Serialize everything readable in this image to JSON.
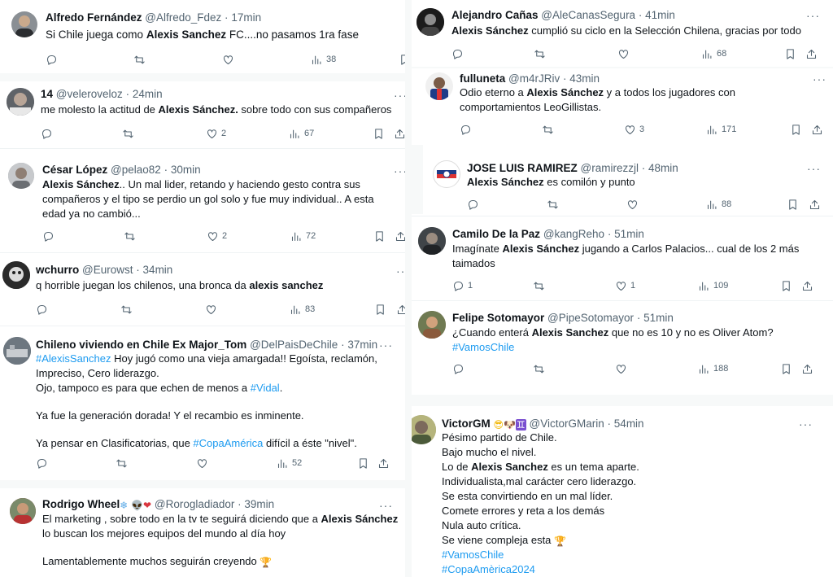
{
  "left": [
    {
      "name": "Alfredo Fernández",
      "handle": "@Alfredo_Fdez",
      "time": "17min",
      "text": "Si Chile juega como ",
      "bold": "Alexis Sanchez",
      "text2": " FC....no pasamos 1ra fase",
      "replies": "",
      "retweets": "",
      "likes": "",
      "views": "38"
    },
    {
      "name": "14",
      "handle": "@veleroveloz",
      "time": "24min",
      "text": "me molesto la actitud de ",
      "bold": "Alexis Sánchez.",
      "text2": " sobre todo con sus compañeros",
      "replies": "",
      "retweets": "",
      "likes": "2",
      "views": "67"
    },
    {
      "name": "César López",
      "handle": "@pelao82",
      "time": "30min",
      "bold": "Alexis Sánchez",
      "text2": ".. Un mal lider, retando y haciendo gesto contra sus",
      "line2": "compañeros y el tipo se perdio un gol solo y fue muy individual.. A esta",
      "line3": "edad ya no cambió...",
      "replies": "",
      "retweets": "",
      "likes": "2",
      "views": "72"
    },
    {
      "name": "wchurro",
      "handle": "@Eurowst",
      "time": "34min",
      "text": "q horrible juegan los chilenos, una bronca da ",
      "bold": "alexis sanchez",
      "replies": "",
      "retweets": "",
      "likes": "",
      "views": "83"
    },
    {
      "name": "Chileno viviendo en Chile Ex Major_Tom",
      "handle": "@DelPaisDeChile",
      "time": "37min",
      "tag1": "#AlexisSanchez",
      "text1": " Hoy jugó como una vieja amargada!! Egoísta, reclamón,",
      "line2": "Impreciso, Cero liderazgo.",
      "line3a": "Ojo, tampoco es para que echen de menos a ",
      "tag2": "#Vidal",
      "line3b": ".",
      "line4": "Ya fue la generación dorada! Y el recambio es inminente.",
      "line5a": "Ya pensar en Clasificatorias, que ",
      "tag3": "#CopaAmérica",
      "line5b": " difícil a éste \"nivel\".",
      "replies": "",
      "retweets": "",
      "likes": "",
      "views": "52"
    },
    {
      "name": "Rodrigo Wheel",
      "handle": "@Rorogladiador",
      "time": "39min",
      "text": "El marketing  , sobre todo en la tv te seguirá diciendo que a ",
      "bold": "Alexis Sánchez",
      "line2": "lo buscan los mejores equipos del mundo al día hoy",
      "line3": "Lamentablemente muchos seguirán creyendo"
    }
  ],
  "right": [
    {
      "name": "Alejandro Cañas",
      "handle": "@AleCanasSegura",
      "time": "41min",
      "bold": "Alexis Sánchez",
      "text2": " cumplió su ciclo en la Selección Chilena, gracias por todo",
      "replies": "",
      "retweets": "",
      "likes": "",
      "views": "68"
    },
    {
      "name": "fulluneta",
      "handle": "@m4rJRiv",
      "time": "43min",
      "text": "Odio eterno a ",
      "bold": "Alexis Sánchez",
      "text2": " y a todos los jugadores con",
      "line2": "comportamientos LeoGillistas.",
      "replies": "",
      "retweets": "",
      "likes": "3",
      "views": "171"
    },
    {
      "name": "JOSE LUIS RAMIREZ",
      "handle": "@ramirezzjl",
      "time": "48min",
      "bold": "Alexis Sánchez",
      "text2": " es comilón y punto",
      "replies": "",
      "retweets": "",
      "likes": "",
      "views": "88"
    },
    {
      "name": "Camilo De la Paz",
      "handle": "@kangReho",
      "time": "51min",
      "text": "Imagínate ",
      "bold": "Alexis Sánchez",
      "text2": " jugando a Carlos Palacios... cual de los 2 más",
      "line2": "taimados",
      "replies": "1",
      "retweets": "",
      "likes": "1",
      "views": "109"
    },
    {
      "name": "Felipe Sotomayor",
      "handle": "@PipeSotomayor",
      "time": "51min",
      "text": "¿Cuando enterá ",
      "bold": "Alexis Sanchez",
      "text2": " que no es 10 y no es Oliver Atom?",
      "tag1": "#VamosChile",
      "replies": "",
      "retweets": "",
      "likes": "",
      "views": "188"
    },
    {
      "name": "VictorGM",
      "handle": "@VictorGMarin",
      "time": "54min",
      "line1": "Pésimo partido de Chile.",
      "line2": "Bajo mucho el nivel.",
      "line3a": "Lo de ",
      "bold": "Alexis Sanchez",
      "line3b": " es un tema aparte.",
      "line4": "Individualista,mal carácter cero liderazgo.",
      "line5": "Se esta convirtiendo en un mal líder.",
      "line6": "Comete errores y reta a los demás",
      "line7": "Nula auto crítica.",
      "line8": "Se viene compleja esta",
      "tag1": "#VamosChile",
      "tag2": "#CopaAmèrica2024"
    }
  ],
  "icons": {
    "more": "more-icon",
    "reply": "reply-icon",
    "retweet": "retweet-icon",
    "like": "like-icon",
    "views": "views-icon",
    "bookmark": "bookmark-icon",
    "share": "share-icon"
  },
  "colors": {
    "link": "#1d9bf0",
    "muted": "#536471",
    "text": "#0f1419"
  }
}
